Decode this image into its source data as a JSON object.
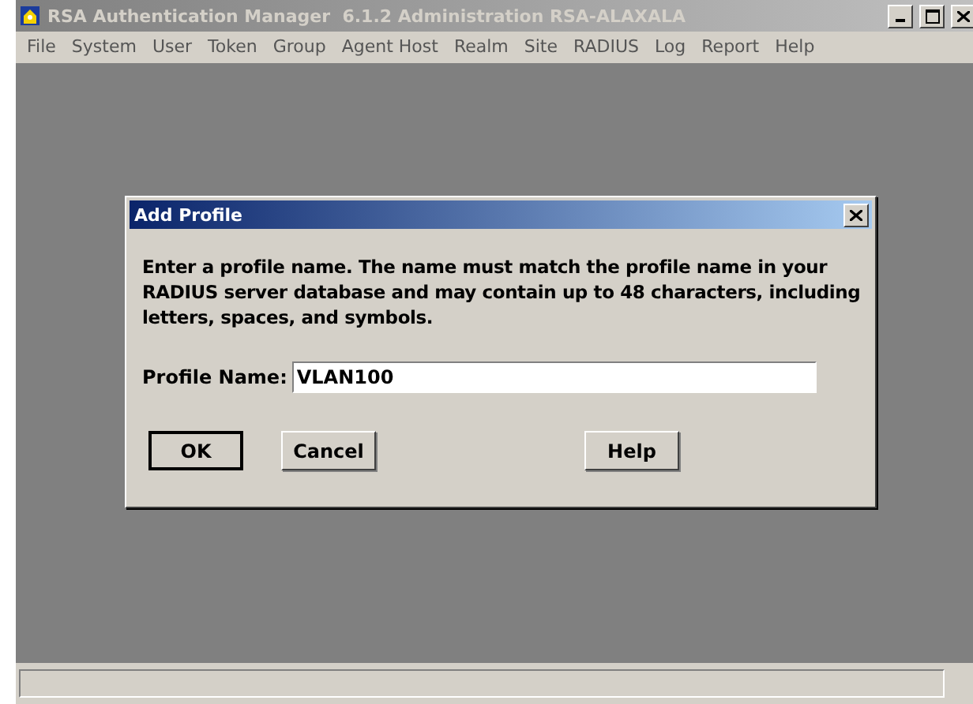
{
  "window": {
    "title": "RSA Authentication Manager  6.1.2 Administration RSA-ALAXALA"
  },
  "menu": [
    "File",
    "System",
    "User",
    "Token",
    "Group",
    "Agent Host",
    "Realm",
    "Site",
    "RADIUS",
    "Log",
    "Report",
    "Help"
  ],
  "dialog": {
    "title": "Add Profile",
    "message": "Enter a profile name. The name must match the profile name in your RADIUS server database and may contain up to 48 characters, including letters, spaces, and symbols.",
    "field": {
      "label": "Profile Name:",
      "value": "VLAN100"
    },
    "buttons": [
      {
        "label": "OK",
        "default": true
      },
      {
        "label": "Cancel",
        "default": false
      },
      {
        "label": "Help",
        "default": false
      }
    ]
  }
}
